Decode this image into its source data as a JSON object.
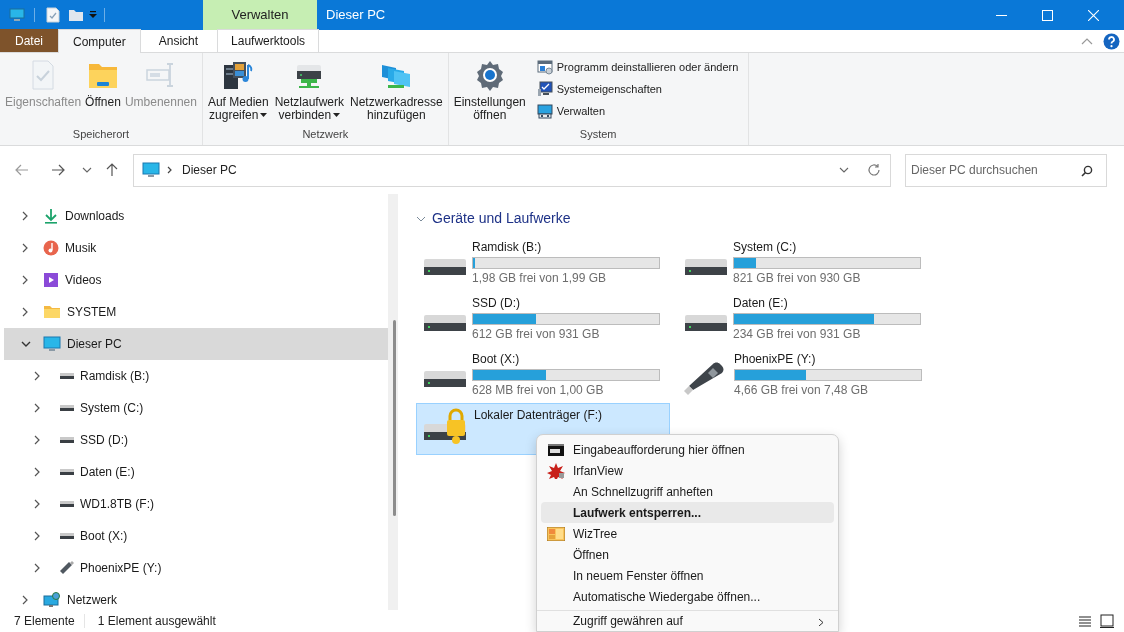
{
  "window": {
    "title": "Dieser PC"
  },
  "context_tab": {
    "label": "Verwalten"
  },
  "ribbon_tabs": [
    {
      "label": "Datei",
      "kind": "file",
      "selected": false
    },
    {
      "label": "Computer",
      "kind": "tab",
      "selected": true
    },
    {
      "label": "Ansicht",
      "kind": "tab",
      "selected": false
    },
    {
      "label": "Laufwerktools",
      "kind": "context",
      "selected": false
    }
  ],
  "ribbon_groups": [
    {
      "label": "Speicherort",
      "buttons": [
        {
          "label": "Eigenschaften",
          "disabled": true
        },
        {
          "label": "Öffnen",
          "disabled": false
        },
        {
          "label": "Umbenennen",
          "disabled": true
        }
      ]
    },
    {
      "label": "Netzwerk",
      "buttons": [
        {
          "label": "Auf Medien\nzugreifen",
          "disabled": false,
          "dropdown": true
        },
        {
          "label": "Netzlaufwerk\nverbinden",
          "disabled": false,
          "dropdown": true
        },
        {
          "label": "Netzwerkadresse\nhinzufügen",
          "disabled": false,
          "dropdown": false
        }
      ]
    },
    {
      "label": "System",
      "buttons": [
        {
          "label": "Einstellungen\nöffnen",
          "disabled": false
        }
      ],
      "small_buttons": [
        {
          "label": "Programm deinstallieren oder ändern"
        },
        {
          "label": "Systemeigenschaften"
        },
        {
          "label": "Verwalten"
        }
      ]
    }
  ],
  "address": {
    "path": [
      "Dieser PC"
    ],
    "search_placeholder": "Dieser PC durchsuchen"
  },
  "tree": [
    {
      "label": "Downloads",
      "kind": "download",
      "expanded": false,
      "selected": false
    },
    {
      "label": "Musik",
      "kind": "music",
      "expanded": false,
      "selected": false
    },
    {
      "label": "Videos",
      "kind": "video",
      "expanded": false,
      "selected": false
    },
    {
      "label": "SYSTEM",
      "kind": "folder",
      "expanded": false,
      "selected": false
    },
    {
      "label": "Dieser PC",
      "kind": "pc",
      "expanded": true,
      "selected": true,
      "children": [
        {
          "label": "Ramdisk (B:)",
          "kind": "drive",
          "expanded": false,
          "selected": false
        },
        {
          "label": "System (C:)",
          "kind": "drive",
          "expanded": false,
          "selected": false
        },
        {
          "label": "SSD (D:)",
          "kind": "drive",
          "expanded": false,
          "selected": false
        },
        {
          "label": "Daten (E:)",
          "kind": "drive",
          "expanded": false,
          "selected": false
        },
        {
          "label": "WD1.8TB (F:)",
          "kind": "drive",
          "expanded": false,
          "selected": false
        },
        {
          "label": "Boot (X:)",
          "kind": "drive",
          "expanded": false,
          "selected": false
        },
        {
          "label": "PhoenixPE (Y:)",
          "kind": "usb",
          "expanded": false,
          "selected": false
        }
      ]
    },
    {
      "label": "Netzwerk",
      "kind": "network",
      "expanded": false,
      "selected": false
    }
  ],
  "section": {
    "title": "Geräte und Laufwerke",
    "expanded": true
  },
  "drives": [
    {
      "name": "Ramdisk (B:)",
      "kind": "hdd",
      "level": 0.01,
      "free": "1,98 GB frei von 1,99 GB",
      "selected": false
    },
    {
      "name": "System (C:)",
      "kind": "hdd",
      "level": 0.12,
      "free": "821 GB frei von 930 GB",
      "selected": false
    },
    {
      "name": "SSD (D:)",
      "kind": "hdd",
      "level": 0.34,
      "free": "612 GB frei von 931 GB",
      "selected": false
    },
    {
      "name": "Daten (E:)",
      "kind": "hdd",
      "level": 0.75,
      "free": "234 GB frei von 931 GB",
      "selected": false
    },
    {
      "name": "Boot (X:)",
      "kind": "hdd",
      "level": 0.39,
      "free": "628 MB frei von 1,00 GB",
      "selected": false
    },
    {
      "name": "PhoenixPE (Y:)",
      "kind": "usb",
      "level": 0.38,
      "free": "4,66 GB frei von 7,48 GB",
      "selected": false
    },
    {
      "name": "Lokaler Datenträger (F:)",
      "kind": "locked",
      "selected": true
    }
  ],
  "context_menu": [
    {
      "label": "Eingabeaufforderung hier öffnen",
      "kind": "item",
      "highlighted": false
    },
    {
      "label": "IrfanView",
      "kind": "item",
      "highlighted": false
    },
    {
      "label": "An Schnellzugriff anheften",
      "kind": "item",
      "highlighted": false
    },
    {
      "label": "Laufwerk entsperren...",
      "kind": "item",
      "highlighted": true
    },
    {
      "label": "WizTree",
      "kind": "item",
      "highlighted": false
    },
    {
      "label": "Öffnen",
      "kind": "item",
      "highlighted": false
    },
    {
      "label": "In neuem Fenster öffnen",
      "kind": "item",
      "highlighted": false
    },
    {
      "label": "Automatische Wiedergabe öffnen...",
      "kind": "item",
      "highlighted": false
    },
    {
      "kind": "separator"
    },
    {
      "label": "Zugriff gewähren auf",
      "kind": "item",
      "highlighted": false,
      "submenu": true
    }
  ],
  "status_bar": {
    "count": "7 Elemente",
    "selection": "1 Element ausgewählt"
  }
}
